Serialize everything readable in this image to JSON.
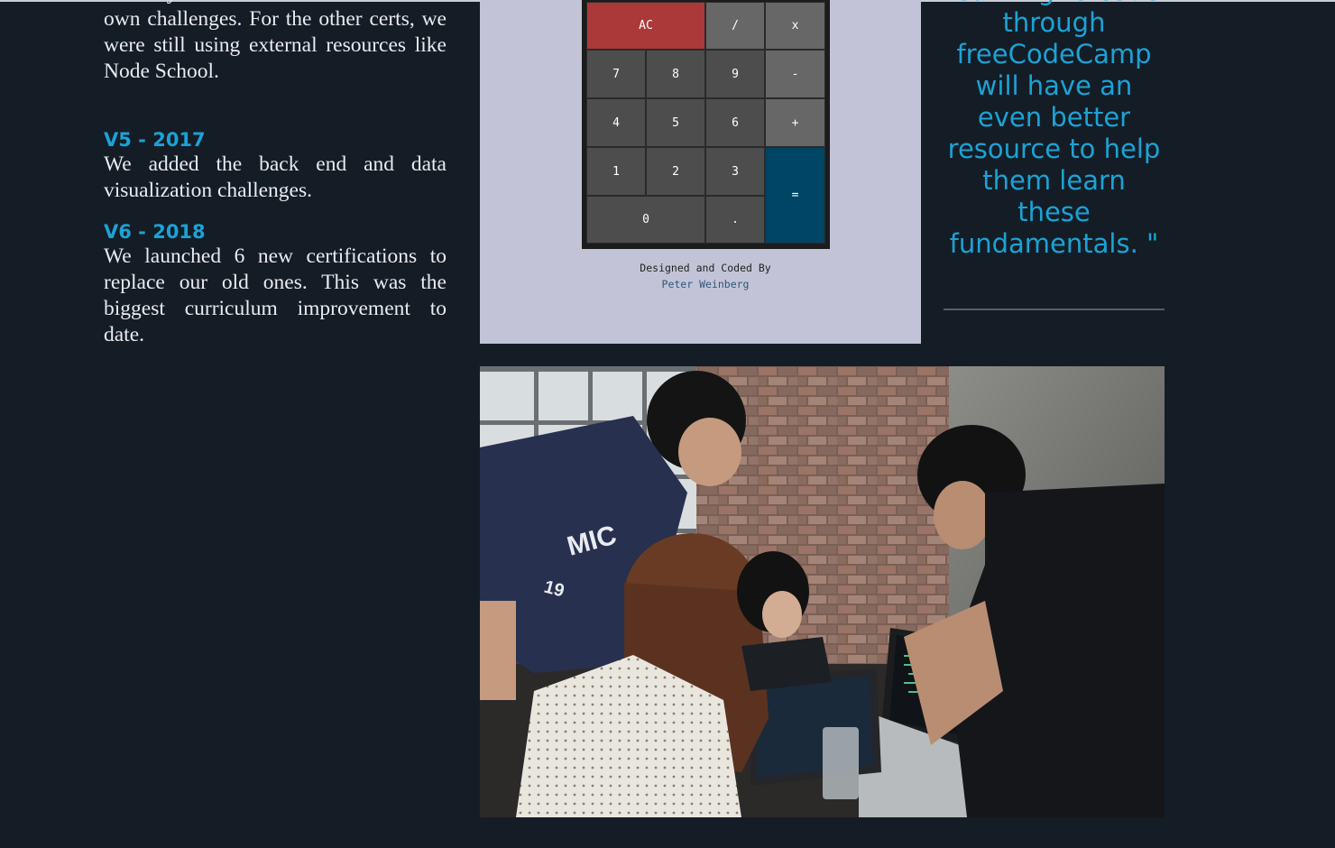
{
  "history": {
    "intro_fragment": "but only the Front End section had its own challenges. For the other certs, we were still using external resources like Node School.",
    "entries": [
      {
        "title": "V5 - 2017",
        "text": "We added the back end and data visualization challenges."
      },
      {
        "title": "V6 - 2018",
        "text": "We launched 6 new certifications to replace our old ones. This was the biggest curriculum improvement to date."
      }
    ]
  },
  "calculator": {
    "keys": {
      "clear": "AC",
      "divide": "/",
      "multiply": "x",
      "seven": "7",
      "eight": "8",
      "nine": "9",
      "subtract": "-",
      "four": "4",
      "five": "5",
      "six": "6",
      "add": "+",
      "one": "1",
      "two": "2",
      "three": "3",
      "equals": "=",
      "zero": "0",
      "decimal": "."
    },
    "credit_line": "Designed and Coded By",
    "author": "Peter Weinberg",
    "colors": {
      "clear": "#ac3939",
      "equals": "#004466",
      "key": "#4d4d4d",
      "operator": "#676767",
      "panel": "#c3c3d8"
    }
  },
  "quote": {
    "text": "learning to code through freeCodeCamp will have an even better resource to help them learn these fundamentals. \""
  },
  "colors": {
    "background": "#141d26",
    "accent": "#1ca2d6",
    "text": "#e9ebf0"
  }
}
